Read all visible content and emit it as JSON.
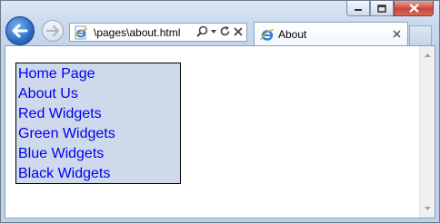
{
  "browser": {
    "address": "\\pages\\about.html",
    "tab_title": "About",
    "controls": {
      "minimize_icon": "minimize-icon",
      "maximize_icon": "maximize-icon",
      "close_icon": "close-icon"
    }
  },
  "page": {
    "menu_background": "#cfd9ec",
    "link_color": "#0000ee",
    "links": [
      "Home Page",
      "About Us",
      "Red Widgets",
      "Green Widgets",
      "Blue Widgets",
      "Black Widgets"
    ]
  }
}
